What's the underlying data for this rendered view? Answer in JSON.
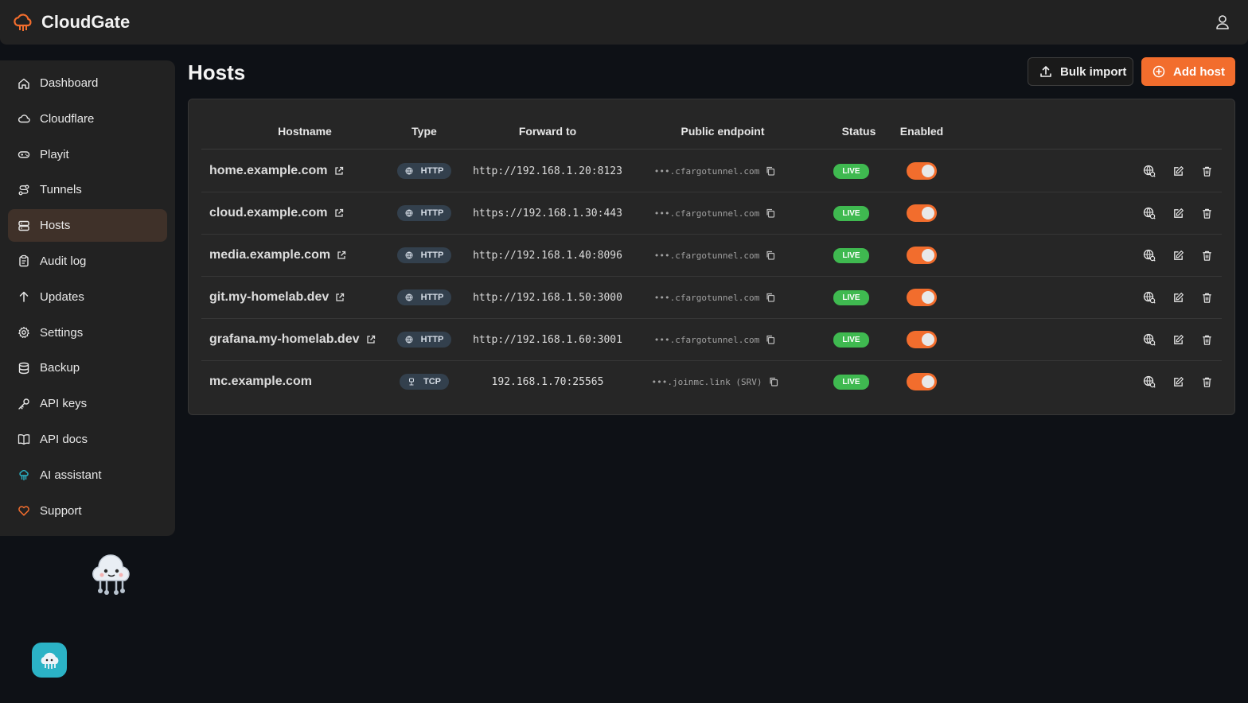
{
  "app": {
    "name": "CloudGate",
    "brand_color": "#f26d2d",
    "user_icon": "user-icon"
  },
  "sidebar": {
    "items": [
      {
        "label": "Dashboard",
        "icon": "home-icon",
        "active": false
      },
      {
        "label": "Cloudflare",
        "icon": "cloud-icon",
        "active": false
      },
      {
        "label": "Playit",
        "icon": "gamepad-icon",
        "active": false
      },
      {
        "label": "Tunnels",
        "icon": "route-icon",
        "active": false
      },
      {
        "label": "Hosts",
        "icon": "server-icon",
        "active": true
      },
      {
        "label": "Audit log",
        "icon": "clipboard-icon",
        "active": false
      },
      {
        "label": "Updates",
        "icon": "arrow-up-icon",
        "active": false
      },
      {
        "label": "Settings",
        "icon": "gear-icon",
        "active": false
      },
      {
        "label": "Backup",
        "icon": "database-icon",
        "active": false
      },
      {
        "label": "API keys",
        "icon": "key-icon",
        "active": false
      },
      {
        "label": "API docs",
        "icon": "book-icon",
        "active": false
      },
      {
        "label": "AI assistant",
        "icon": "bot-icon",
        "active": false
      },
      {
        "label": "Support",
        "icon": "heart-icon",
        "active": false
      }
    ]
  },
  "page": {
    "title": "Hosts",
    "bulk_import_label": "Bulk import",
    "add_host_label": "Add host"
  },
  "table": {
    "columns": [
      "Hostname",
      "Type",
      "Forward to",
      "Public endpoint",
      "Status",
      "Enabled"
    ],
    "rows": [
      {
        "hostname": "home.example.com",
        "external_link": true,
        "type": "HTTP",
        "forward_to": "http://192.168.1.20:8123",
        "endpoint": "•••.cfargotunnel.com",
        "status": "LIVE",
        "enabled": true
      },
      {
        "hostname": "cloud.example.com",
        "external_link": true,
        "type": "HTTP",
        "forward_to": "https://192.168.1.30:443",
        "endpoint": "•••.cfargotunnel.com",
        "status": "LIVE",
        "enabled": true
      },
      {
        "hostname": "media.example.com",
        "external_link": true,
        "type": "HTTP",
        "forward_to": "http://192.168.1.40:8096",
        "endpoint": "•••.cfargotunnel.com",
        "status": "LIVE",
        "enabled": true
      },
      {
        "hostname": "git.my-homelab.dev",
        "external_link": true,
        "type": "HTTP",
        "forward_to": "http://192.168.1.50:3000",
        "endpoint": "•••.cfargotunnel.com",
        "status": "LIVE",
        "enabled": true
      },
      {
        "hostname": "grafana.my-homelab.dev",
        "external_link": true,
        "type": "HTTP",
        "forward_to": "http://192.168.1.60:3001",
        "endpoint": "•••.cfargotunnel.com",
        "status": "LIVE",
        "enabled": true
      },
      {
        "hostname": "mc.example.com",
        "external_link": false,
        "type": "TCP",
        "forward_to": "192.168.1.70:25565",
        "endpoint": "•••.joinmc.link (SRV)",
        "status": "LIVE",
        "enabled": true
      }
    ]
  },
  "colors": {
    "live": "#3fb950",
    "toggle_on": "#f26d2d",
    "active_nav": "#3f3129",
    "chat_fab": "#2bb3c6"
  }
}
